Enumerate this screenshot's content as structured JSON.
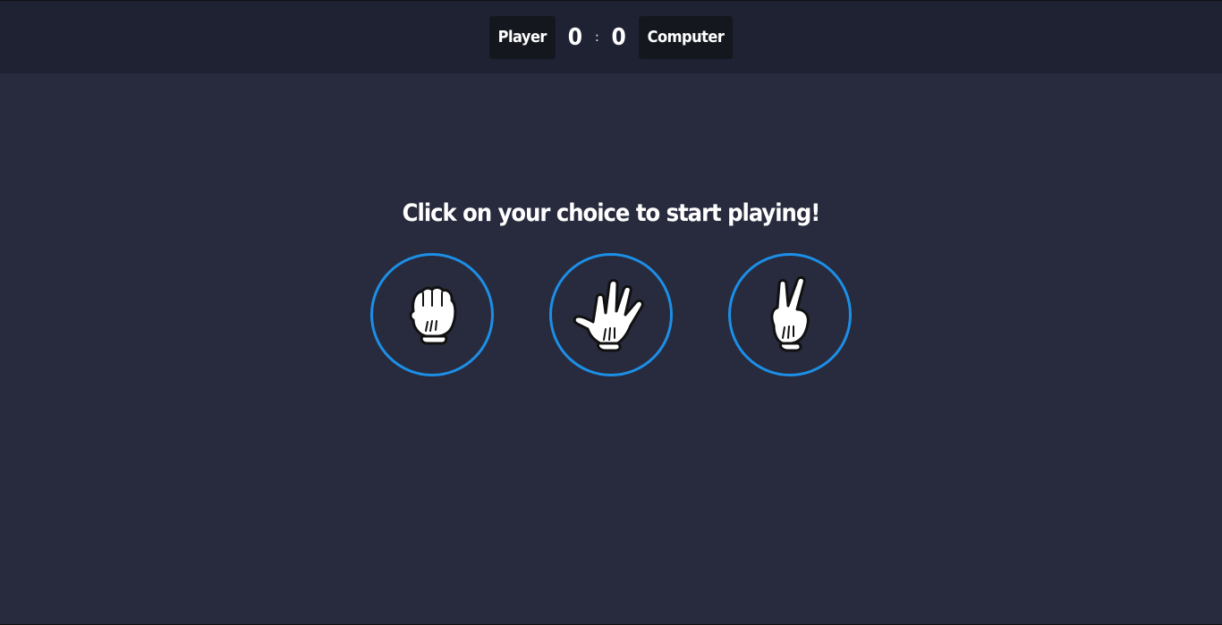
{
  "scoreboard": {
    "player_label": "Player",
    "player_score": "0",
    "separator": ":",
    "computer_score": "0",
    "computer_label": "Computer"
  },
  "prompt": "Click on your choice to start playing!",
  "choices": [
    {
      "id": "rock",
      "icon": "rock-hand-icon"
    },
    {
      "id": "paper",
      "icon": "paper-hand-icon"
    },
    {
      "id": "scissors",
      "icon": "scissors-hand-icon"
    }
  ],
  "colors": {
    "background": "#282b3e",
    "header": "#1f2233",
    "badge": "#15171f",
    "accent": "#1c8fe6"
  }
}
